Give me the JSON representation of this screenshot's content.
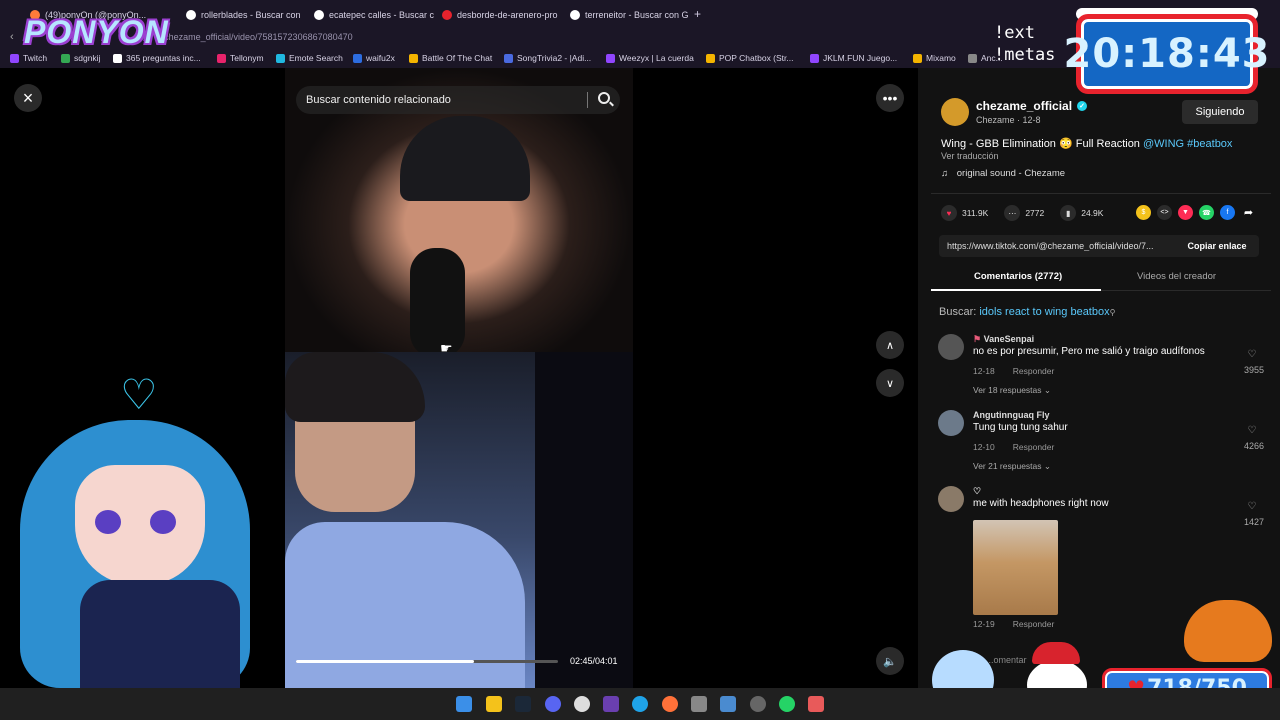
{
  "tabs": [
    {
      "label": "(49)ponyOn (@ponyOn...",
      "color": "#ff7b3a"
    },
    {
      "label": "rollerblades - Buscar con",
      "color": "#ffffff"
    },
    {
      "label": "ecatepec calles - Buscar c",
      "color": "#ffffff"
    },
    {
      "label": "desborde-de-arenero-pro",
      "color": "#e8232d"
    },
    {
      "label": "terreneitor - Buscar con G",
      "color": "#ffffff"
    }
  ],
  "newtab": "+",
  "url": "@chezame_official/video/7581572306867080470",
  "bookmarks": [
    {
      "label": "Twitch",
      "color": "#9146ff"
    },
    {
      "label": "sdgnkij",
      "color": "#34a853"
    },
    {
      "label": "365 preguntas inc...",
      "color": "#ffffff"
    },
    {
      "label": "Tellonym",
      "color": "#e8236b"
    },
    {
      "label": "Emote Search",
      "color": "#20b8e0"
    },
    {
      "label": "waifu2x",
      "color": "#2d6de0"
    },
    {
      "label": "Battle Of The Chat",
      "color": "#f4b400"
    },
    {
      "label": "SongTrivia2 - |Adi...",
      "color": "#4a6ae0"
    },
    {
      "label": "Weezyx | La cuerda",
      "color": "#9146ff"
    },
    {
      "label": "POP Chatbox (Str...",
      "color": "#f4b400"
    },
    {
      "label": "JKLM.FUN Juego...",
      "color": "#9146ff"
    },
    {
      "label": "Mixamo",
      "color": "#f4b400"
    },
    {
      "label": "Anc...",
      "color": "#888888"
    }
  ],
  "overlay": {
    "logo": "PONYON",
    "command_lines": [
      "!ext",
      "!metas"
    ],
    "clock": "20:18:43",
    "donation": "718/750"
  },
  "video": {
    "search_placeholder": "Buscar contenido relacionado",
    "progress_fraction": 0.68,
    "time": "02:45/04:01"
  },
  "post": {
    "username": "chezame_official",
    "subtitle": "Chezame · 12-8",
    "follow_label": "Siguiendo",
    "caption_text": "Wing - GBB Elimination 😳 Full Reaction ",
    "caption_tags": "@WING #beatbox",
    "translate": "Ver traducción",
    "music": "original sound - Chezame",
    "likes": "311.9K",
    "comments_count": "2772",
    "saves": "24.9K",
    "link": "https://www.tiktok.com/@chezame_official/video/7...",
    "copy_label": "Copiar enlace",
    "tab_comments": "Comentarios (2772)",
    "tab_videos": "Videos del creador",
    "search_label": "Buscar: ",
    "search_query": "idols react to wing beatbox",
    "comment_placeholder": "...omentar"
  },
  "comments": [
    {
      "user": "VaneSenpai",
      "text": "no es por presumir, Pero me salió y traigo audífonos",
      "date": "12-18",
      "reply": "Responder",
      "replies": "Ver 18 respuestas",
      "likes": "3955"
    },
    {
      "user": "Angutinnguaq Fly",
      "text": "Tung tung tung sahur",
      "date": "12-10",
      "reply": "Responder",
      "replies": "Ver 21 respuestas",
      "likes": "4266"
    },
    {
      "user": "♡",
      "text": "me with headphones right now",
      "date": "12-19",
      "reply": "Responder",
      "likes": "1427"
    }
  ],
  "icons": {
    "close": "×",
    "more": "•••",
    "up": "∧",
    "down": "∨",
    "volume": "🔈",
    "heart": "♥",
    "comment": "•••",
    "bookmark": "▮",
    "music": "♫",
    "like_outline": "♡",
    "chevron_down": "⌄"
  }
}
